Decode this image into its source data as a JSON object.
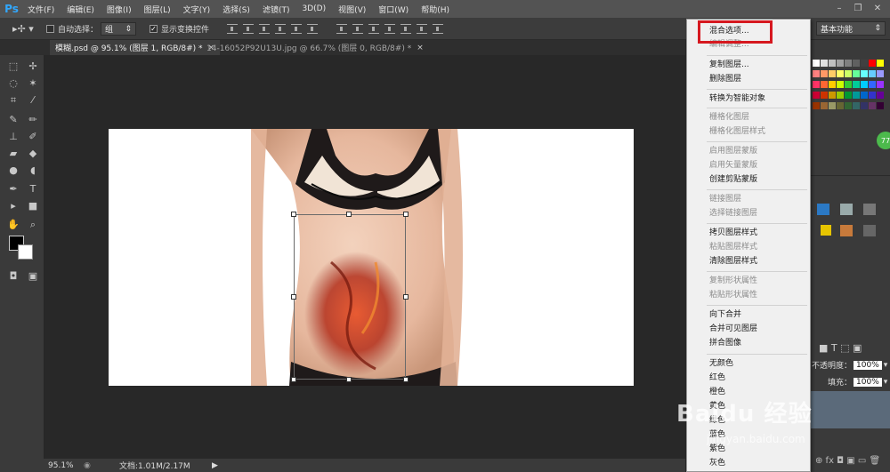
{
  "menubar": {
    "logo": "Ps",
    "items": [
      "文件(F)",
      "编辑(E)",
      "图像(I)",
      "图层(L)",
      "文字(Y)",
      "选择(S)",
      "滤镜(T)",
      "3D(D)",
      "视图(V)",
      "窗口(W)",
      "帮助(H)"
    ]
  },
  "window_controls": {
    "minimize": "–",
    "restore": "❐",
    "close": "✕"
  },
  "options": {
    "auto_select_label": "自动选择：",
    "auto_select_value": "组",
    "show_transform_label": "显示变换控件",
    "show_transform_checked": "✓"
  },
  "workspace": {
    "label": "基本功能"
  },
  "tabs": [
    {
      "label": "模糊.psd @ 95.1% (图层 1, RGB/8#) *",
      "close": "×"
    },
    {
      "label": "14-16052P92U13U.jpg @ 66.7% (图层 0, RGB/8#) *",
      "close": "×"
    }
  ],
  "status": {
    "zoom": "95.1%",
    "doc_info": "文档:1.01M/2.17M",
    "arrow": "▶"
  },
  "context_menu": {
    "items": [
      {
        "label": "混合选项...",
        "enabled": true
      },
      {
        "label": "编辑调整...",
        "enabled": false
      },
      {
        "label": "复制图层...",
        "enabled": true
      },
      {
        "label": "删除图层",
        "enabled": true
      },
      {
        "label": "转换为智能对象",
        "enabled": true
      },
      {
        "label": "栅格化图层",
        "enabled": false
      },
      {
        "label": "栅格化图层样式",
        "enabled": false
      },
      {
        "label": "启用图层蒙版",
        "enabled": false
      },
      {
        "label": "启用矢量蒙版",
        "enabled": false
      },
      {
        "label": "创建剪贴蒙版",
        "enabled": true
      },
      {
        "label": "链接图层",
        "enabled": false
      },
      {
        "label": "选择链接图层",
        "enabled": false
      },
      {
        "label": "拷贝图层样式",
        "enabled": true
      },
      {
        "label": "粘贴图层样式",
        "enabled": false
      },
      {
        "label": "清除图层样式",
        "enabled": true
      },
      {
        "label": "复制形状属性",
        "enabled": false
      },
      {
        "label": "粘贴形状属性",
        "enabled": false
      },
      {
        "label": "向下合并",
        "enabled": true
      },
      {
        "label": "合并可见图层",
        "enabled": true
      },
      {
        "label": "拼合图像",
        "enabled": true
      },
      {
        "label": "无颜色",
        "enabled": true
      },
      {
        "label": "红色",
        "enabled": true
      },
      {
        "label": "橙色",
        "enabled": true
      },
      {
        "label": "黄色",
        "enabled": true
      },
      {
        "label": "绿色",
        "enabled": true
      },
      {
        "label": "蓝色",
        "enabled": true
      },
      {
        "label": "紫色",
        "enabled": true
      },
      {
        "label": "灰色",
        "enabled": true
      }
    ]
  },
  "layers_panel": {
    "opacity_label": "不透明度：",
    "opacity_value": "100%",
    "fill_label": "填充：",
    "fill_value": "100%",
    "badge": "77"
  },
  "watermark": {
    "brand": "Baidu 经验",
    "url": "jingyan.baidu.com"
  },
  "colors": {
    "menubar": "#535353",
    "panel": "#3a3a3a",
    "canvas": "#282828",
    "highlight_box": "#d6181f",
    "ps_blue": "#31a8ff"
  },
  "swatch_colors": [
    "#ffffff",
    "#e0e0e0",
    "#c0c0c0",
    "#a0a0a0",
    "#808080",
    "#606060",
    "#404040",
    "#ff0000",
    "#ffff00",
    "#ff8080",
    "#ff9966",
    "#ffcc66",
    "#ffff66",
    "#ccff66",
    "#66ff99",
    "#66ffff",
    "#66ccff",
    "#9999ff",
    "#ff3366",
    "#ff6633",
    "#ffcc00",
    "#ccff00",
    "#33cc33",
    "#00cc99",
    "#00ccff",
    "#3366ff",
    "#9933ff",
    "#cc0033",
    "#cc3300",
    "#cc9900",
    "#99cc00",
    "#009933",
    "#009999",
    "#0066cc",
    "#3333cc",
    "#660099",
    "#993300",
    "#996633",
    "#999966",
    "#666633",
    "#336633",
    "#336666",
    "#333366",
    "#663366",
    "#330033"
  ]
}
